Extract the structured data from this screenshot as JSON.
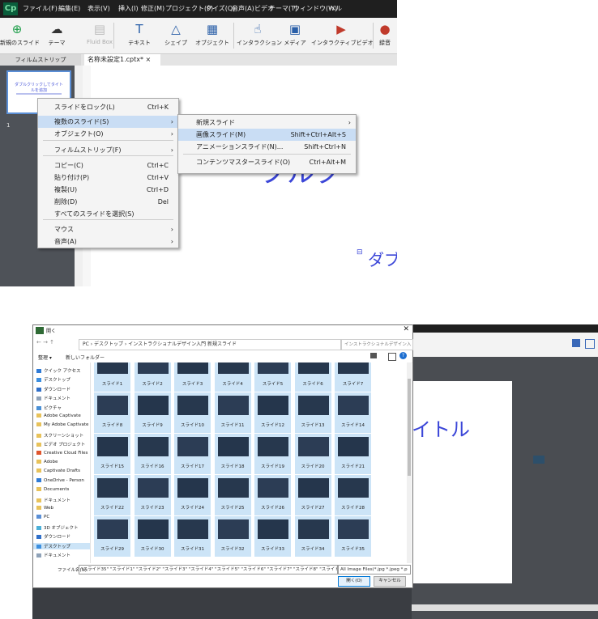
{
  "app_menu": {
    "logo": "Cp",
    "items": [
      "ファイル(F)",
      "編集(E)",
      "表示(V)",
      "挿入(I)",
      "修正(M)",
      "プロジェクト(P)",
      "クイズ(Q)",
      "音声(A)",
      "ビデオ",
      "テーマ(T)",
      "ウィンドウ(W)",
      "ヘル"
    ]
  },
  "toolbar": {
    "items": [
      {
        "label": "新規のスライド",
        "icon": "add-circle-icon"
      },
      {
        "label": "テーマ",
        "icon": "palette-icon"
      },
      {
        "label": "Fluid Box",
        "icon": "fluid-box-icon"
      },
      {
        "label": "テキスト",
        "icon": "text-icon"
      },
      {
        "label": "シェイプ",
        "icon": "shapes-icon"
      },
      {
        "label": "オブジェクト",
        "icon": "object-icon"
      },
      {
        "label": "インタラクション",
        "icon": "hand-icon"
      },
      {
        "label": "メディア",
        "icon": "media-icon"
      },
      {
        "label": "インタラクティブビデオ",
        "icon": "interactive-video-icon"
      },
      {
        "label": "録音",
        "icon": "microphone-icon"
      }
    ]
  },
  "tabs": {
    "filmstrip": "フィルムストリップ",
    "document": "名称未設定1.cptx* ×"
  },
  "filmstrip": {
    "thumb_title": "ダブルクリックしてタイトルを追加",
    "thumb_sub": "ダブルクリックしてサブタイトルを追加",
    "slide_number": "1"
  },
  "canvas": {
    "title_fragment": "ブルク",
    "sub_fragment": "ダブ",
    "sub_icon": "⊟"
  },
  "context_menu": {
    "items": [
      {
        "label": "スライドをロック(L)",
        "key": "Ctrl+K",
        "submenu": false
      },
      {
        "label": "複数のスライド(S)",
        "key": "",
        "submenu": true,
        "highlight": true
      },
      {
        "label": "オブジェクト(O)",
        "key": "",
        "submenu": true
      },
      {
        "label": "フィルムストリップ(F)",
        "key": "",
        "submenu": true
      },
      {
        "label": "コピー(C)",
        "key": "Ctrl+C",
        "submenu": false
      },
      {
        "label": "貼り付け(P)",
        "key": "Ctrl+V",
        "submenu": false
      },
      {
        "label": "複製(U)",
        "key": "Ctrl+D",
        "submenu": false
      },
      {
        "label": "削除(D)",
        "key": "Del",
        "submenu": false
      },
      {
        "label": "すべてのスライドを選択(S)",
        "key": "",
        "submenu": false
      },
      {
        "label": "マウス",
        "key": "",
        "submenu": true
      },
      {
        "label": "音声(A)",
        "key": "",
        "submenu": true
      }
    ]
  },
  "submenu": {
    "items": [
      {
        "label": "新規スライド",
        "key": "",
        "submenu": true
      },
      {
        "label": "画像スライド(M)",
        "key": "Shift+Ctrl+Alt+S",
        "highlight": true
      },
      {
        "label": "アニメーションスライド(N)...",
        "key": "Shift+Ctrl+N"
      },
      {
        "label": "コンテンツマスタースライド(O)",
        "key": "Ctrl+Alt+M"
      }
    ]
  },
  "dialog": {
    "title": "開く",
    "path": "PC › デスクトップ › インストラクショナルデザイン入門 新規スライド",
    "search_placeholder": "インストラクショナルデザイン入門",
    "organize": "整理 ▾",
    "new_folder": "新しいフォルダー",
    "nav": [
      {
        "label": "クイック アクセス",
        "color": "#2f7bd6"
      },
      {
        "label": "デスクトップ",
        "color": "#3c8fe0"
      },
      {
        "label": "ダウンロード",
        "color": "#2f6fc9"
      },
      {
        "label": "ドキュメント",
        "color": "#8fa2b8"
      },
      {
        "label": "ピクチャ",
        "color": "#4a90d6"
      },
      {
        "label": "Adobe Captivate",
        "color": "#e8c25a"
      },
      {
        "label": "My Adobe Captivate",
        "color": "#e8c25a"
      },
      {
        "label": "スクリーンショット",
        "color": "#e8c25a"
      },
      {
        "label": "ビデオ プロジェクト",
        "color": "#e8c25a"
      },
      {
        "label": "Creative Cloud Files",
        "color": "#e0552d"
      },
      {
        "label": "Adobe",
        "color": "#e8c25a"
      },
      {
        "label": "Captivate Drafts",
        "color": "#e8c25a"
      },
      {
        "label": "OneDrive - Person",
        "color": "#2f7bd6"
      },
      {
        "label": "Documents",
        "color": "#e8c25a"
      },
      {
        "label": "ドキュメント",
        "color": "#e8c25a"
      },
      {
        "label": "Web",
        "color": "#e8c25a"
      },
      {
        "label": "PC",
        "color": "#5b8fd6"
      },
      {
        "label": "3D オブジェクト",
        "color": "#4cb0d8"
      },
      {
        "label": "ダウンロード",
        "color": "#2f6fc9"
      },
      {
        "label": "デスクトップ",
        "color": "#3c8fe0",
        "selected": true
      },
      {
        "label": "ドキュメント",
        "color": "#8fa2b8"
      }
    ],
    "files": [
      "スライド1",
      "スライド2",
      "スライド3",
      "スライド4",
      "スライド5",
      "スライド6",
      "スライド7",
      "スライド8",
      "スライド9",
      "スライド10",
      "スライド11",
      "スライド12",
      "スライド13",
      "スライド14",
      "スライド15",
      "スライド16",
      "スライド17",
      "スライド18",
      "スライド19",
      "スライド20",
      "スライド21",
      "スライド22",
      "スライド23",
      "スライド24",
      "スライド25",
      "スライド26",
      "スライド27",
      "スライド28",
      "スライド29",
      "スライド30",
      "スライド31",
      "スライド32",
      "スライド33",
      "スライド34",
      "スライド35"
    ],
    "filename_label": "ファイル名(N):",
    "filename_value": "\"スライド35\" \"スライド1\" \"スライド2\" \"スライド3\" \"スライド4\" \"スライド5\" \"スライド6\" \"スライド7\" \"スライド8\" \"スライド9\"",
    "filetype": "All Image Files(*.jpg *.jpeg *.p",
    "open_button": "開く(O)",
    "cancel_button": "キャンセル"
  },
  "background_app": {
    "title_fragment": "イトル"
  }
}
